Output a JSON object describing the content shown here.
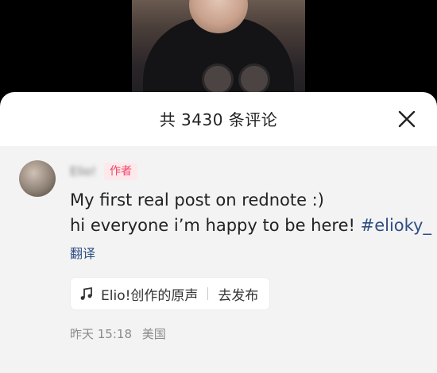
{
  "sheet": {
    "title": "共 3430 条评论"
  },
  "comment": {
    "author_name": "Elio!",
    "author_tag": "作者",
    "line1": "My first real post on rednote :)",
    "line2_text": "hi everyone i’m happy to be here! ",
    "hashtag": "#elioky_",
    "translate_label": "翻译",
    "audio_label": "Elio!创作的原声",
    "publish_label": "去发布",
    "time": "昨天 15:18",
    "location": "美国"
  }
}
